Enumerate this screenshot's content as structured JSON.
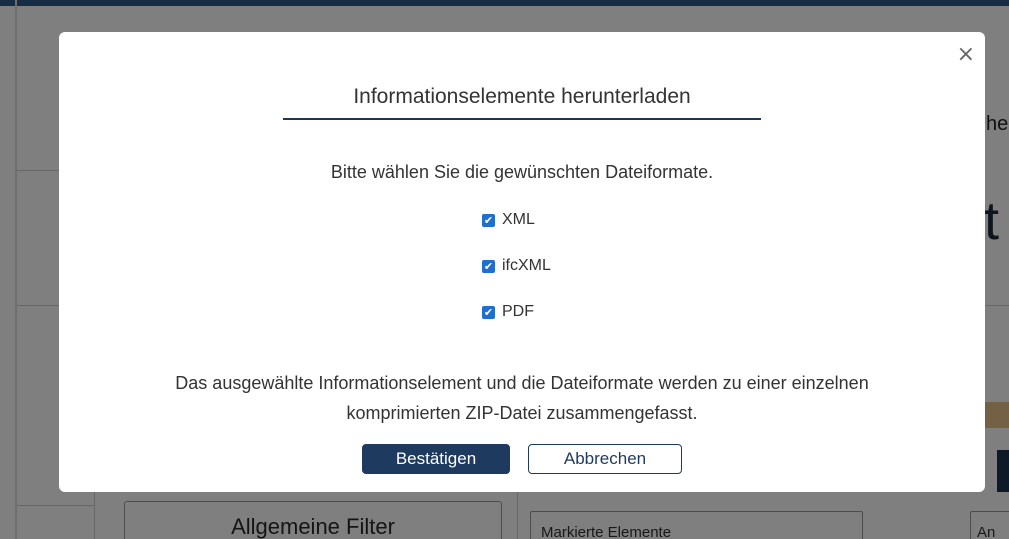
{
  "background": {
    "fragment_he": "he",
    "fragment_letter": "t",
    "filter_button": "Allgemeine Filter",
    "marked_elements": "Markierte Elemente",
    "an_fragment": "An"
  },
  "modal": {
    "close_icon": "×",
    "title": "Informationselemente herunterladen",
    "instruction": "Bitte wählen Sie die gewünschten Dateiformate.",
    "formats": [
      {
        "label": "XML",
        "checked": true
      },
      {
        "label": "ifcXML",
        "checked": true
      },
      {
        "label": "PDF",
        "checked": true
      }
    ],
    "checkmark": "✔",
    "note_line1": "Das ausgewählte Informationselement und die Dateiformate werden zu einer einzelnen",
    "note_line2": "komprimierten ZIP-Datei zusammengefasst.",
    "confirm_label": "Bestätigen",
    "cancel_label": "Abbrechen"
  },
  "colors": {
    "primary": "#1f3a5f",
    "checkbox": "#1f6fd1",
    "overlay": "rgba(0,0,0,0.5)"
  }
}
